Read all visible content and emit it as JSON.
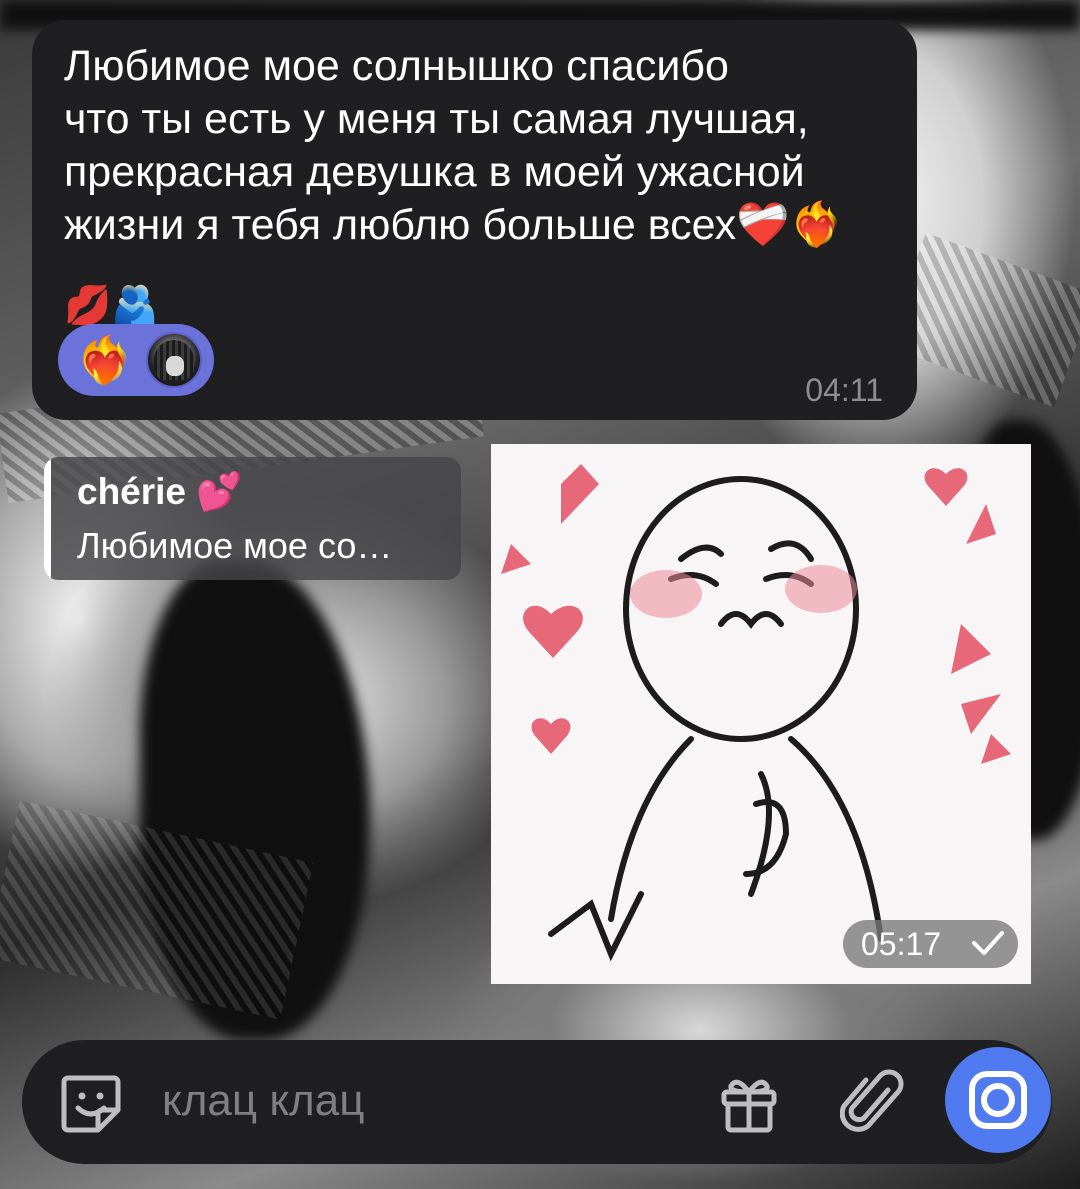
{
  "messages": {
    "incoming": {
      "text": "Любимое мое солнышко спасибо\nчто ты есть у меня ты самая лучшая,\nпрекрасная девушка в моей ужасной\nжизни я тебя люблю больше всех❤️‍🩹❤️‍🔥",
      "emoji_line": "💋🫂",
      "reaction_emoji": "❤️‍🔥",
      "time": "04:11"
    },
    "reply": {
      "name": "chérie 💕",
      "preview": "Любимое мое со…"
    },
    "sticker": {
      "time": "05:17",
      "status": "sent"
    }
  },
  "composer": {
    "placeholder": "клац клац"
  },
  "colors": {
    "bubble": "#1f1f22",
    "reaction": "#6b72d9",
    "accent": "#4f7af0",
    "time_text": "#8d8d92"
  },
  "icons": {
    "sticker": "sticker-icon",
    "gift": "gift-icon",
    "attach": "paperclip-icon",
    "camera": "camera-icon",
    "check": "check-icon"
  }
}
